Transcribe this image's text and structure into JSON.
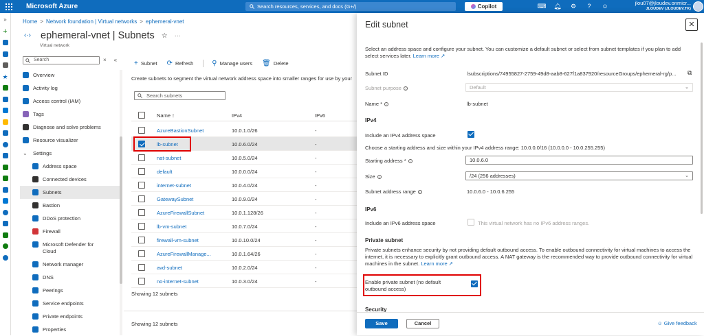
{
  "topbar": {
    "brand": "Microsoft Azure",
    "search_placeholder": "Search resources, services, and docs (G+/)",
    "copilot": "Copilot",
    "account_name": "jlou07@jloudev.onmicr...",
    "account_tenant": "JLOUDEV (JLOUDEV.TK)"
  },
  "breadcrumb": {
    "home": "Home",
    "parent": "Network foundation | Virtual networks",
    "current": "ephemeral-vnet"
  },
  "page": {
    "title": "ephemeral-vnet | Subnets",
    "subtitle": "Virtual network"
  },
  "leftnav": {
    "search_placeholder": "Search",
    "items": [
      {
        "label": "Overview",
        "color": "#0f6cbd"
      },
      {
        "label": "Activity log",
        "color": "#0f6cbd"
      },
      {
        "label": "Access control (IAM)",
        "color": "#0f6cbd"
      },
      {
        "label": "Tags",
        "color": "#8764b8"
      },
      {
        "label": "Diagnose and solve problems",
        "color": "#323130"
      },
      {
        "label": "Resource visualizer",
        "color": "#0f6cbd"
      },
      {
        "label": "Settings",
        "color": ""
      },
      {
        "label": "Address space",
        "color": "#0f6cbd"
      },
      {
        "label": "Connected devices",
        "color": "#323130"
      },
      {
        "label": "Subnets",
        "color": "#0f6cbd"
      },
      {
        "label": "Bastion",
        "color": "#323130"
      },
      {
        "label": "DDoS protection",
        "color": "#0f6cbd"
      },
      {
        "label": "Firewall",
        "color": "#d13438"
      },
      {
        "label": "Microsoft Defender for",
        "label2": "Cloud",
        "color": "#0f6cbd"
      },
      {
        "label": "Network manager",
        "color": "#0f6cbd"
      },
      {
        "label": "DNS",
        "color": "#0f6cbd"
      },
      {
        "label": "Peerings",
        "color": "#0f6cbd"
      },
      {
        "label": "Service endpoints",
        "color": "#0f6cbd"
      },
      {
        "label": "Private endpoints",
        "color": "#0f6cbd"
      },
      {
        "label": "Properties",
        "color": "#0f6cbd"
      }
    ]
  },
  "toolbar": {
    "subnet": "Subnet",
    "refresh": "Refresh",
    "manage_users": "Manage users",
    "delete": "Delete"
  },
  "subnets": {
    "description": "Create subnets to segment the virtual network address space into smaller ranges for use by your",
    "search_placeholder": "Search subnets",
    "col_name": "Name ↑",
    "col_ipv4": "IPv4",
    "col_ipv6": "IPv6",
    "rows": [
      {
        "name": "AzureBastionSubnet",
        "ipv4": "10.0.1.0/26",
        "ipv6": "-"
      },
      {
        "name": "lb-subnet",
        "ipv4": "10.0.6.0/24",
        "ipv6": "-"
      },
      {
        "name": "nat-subnet",
        "ipv4": "10.0.5.0/24",
        "ipv6": "-"
      },
      {
        "name": "default",
        "ipv4": "10.0.0.0/24",
        "ipv6": "-"
      },
      {
        "name": "internet-subnet",
        "ipv4": "10.0.4.0/24",
        "ipv6": "-"
      },
      {
        "name": "GatewaySubnet",
        "ipv4": "10.0.9.0/24",
        "ipv6": "-"
      },
      {
        "name": "AzureFirewallSubnet",
        "ipv4": "10.0.1.128/26",
        "ipv6": "-"
      },
      {
        "name": "lb-vm-subnet",
        "ipv4": "10.0.7.0/24",
        "ipv6": "-"
      },
      {
        "name": "firewall-vm-subnet",
        "ipv4": "10.0.10.0/24",
        "ipv6": "-"
      },
      {
        "name": "AzureFirewallManage...",
        "ipv4": "10.0.1.64/26",
        "ipv6": "-"
      },
      {
        "name": "avd-subnet",
        "ipv4": "10.0.2.0/24",
        "ipv6": "-"
      },
      {
        "name": "no-internet-subnet",
        "ipv4": "10.0.3.0/24",
        "ipv6": "-"
      }
    ],
    "showing_1": "Showing 12 subnets",
    "showing_2": "Showing 12 subnets"
  },
  "panel": {
    "title": "Edit subnet",
    "intro": "Select an address space and configure your subnet. You can customize a default subnet or select from subnet templates if you plan to add select services later.",
    "learn_more": "Learn more",
    "subnet_id_label": "Subnet ID",
    "subnet_id_value": "/subscriptions/74955827-2759-49d8-aab8-627f1a837920/resourceGroups/ephemeral-rg/p...",
    "purpose_label": "Subnet purpose",
    "purpose_value": "Default",
    "name_label": "Name *",
    "name_value": "lb-subnet",
    "ipv4_heading": "IPv4",
    "include_ipv4": "Include an IPv4 address space",
    "choose_text": "Choose a starting address and size within your IPv4 address range: 10.0.0.0/16 (10.0.0.0 - 10.0.255.255)",
    "starting_label": "Starting address *",
    "starting_value": "10.0.6.0",
    "size_label": "Size",
    "size_value": "/24 (256 addresses)",
    "range_label": "Subnet address range",
    "range_value": "10.0.6.0 - 10.0.6.255",
    "ipv6_heading": "IPv6",
    "include_ipv6": "Include an IPv6 address space",
    "ipv6_note": "This virtual network has no IPv6 address ranges.",
    "private_heading": "Private subnet",
    "private_text": "Private subnets enhance security by not providing default outbound access. To enable outbound connectivity for virtual machines to access the internet, it is necessary to explicitly grant outbound access. A NAT gateway is the recommended way to provide outbound connectivity for virtual machines in the subnet.",
    "private_learn": "Learn more",
    "enable_private_1": "Enable private subnet (no default",
    "enable_private_2": "outbound access)",
    "security_heading": "Security",
    "save": "Save",
    "cancel": "Cancel",
    "feedback": "Give feedback"
  }
}
